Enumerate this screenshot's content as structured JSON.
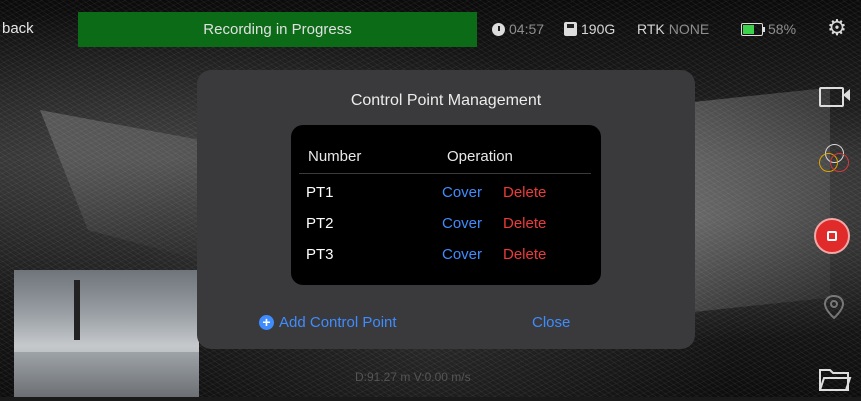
{
  "topbar": {
    "back_label": "back",
    "recording_label": "Recording in Progress",
    "time": "04:57",
    "storage": "190G",
    "rtk_label": "RTK",
    "rtk_status": "NONE",
    "battery": "58%"
  },
  "modal": {
    "title": "Control Point Management",
    "columns": {
      "number": "Number",
      "operation": "Operation"
    },
    "rows": [
      {
        "id": "PT1",
        "cover": "Cover",
        "delete": "Delete"
      },
      {
        "id": "PT2",
        "cover": "Cover",
        "delete": "Delete"
      },
      {
        "id": "PT3",
        "cover": "Cover",
        "delete": "Delete"
      }
    ],
    "add_label": "Add Control Point",
    "close_label": "Close"
  },
  "readout": "D:91.27 m V:0.00 m/s",
  "icons": {
    "settings": "gear-icon",
    "camera": "video-camera-icon",
    "layers": "layers-icon",
    "stop": "stop-record-icon",
    "pin": "location-pin-icon",
    "folder": "folder-icon"
  },
  "colors": {
    "recording_banner": "#0b6b17",
    "link_blue": "#3f8cff",
    "delete_red": "#ee3a3a",
    "battery_green": "#3bd14a",
    "stop_red": "#e12a2a"
  }
}
